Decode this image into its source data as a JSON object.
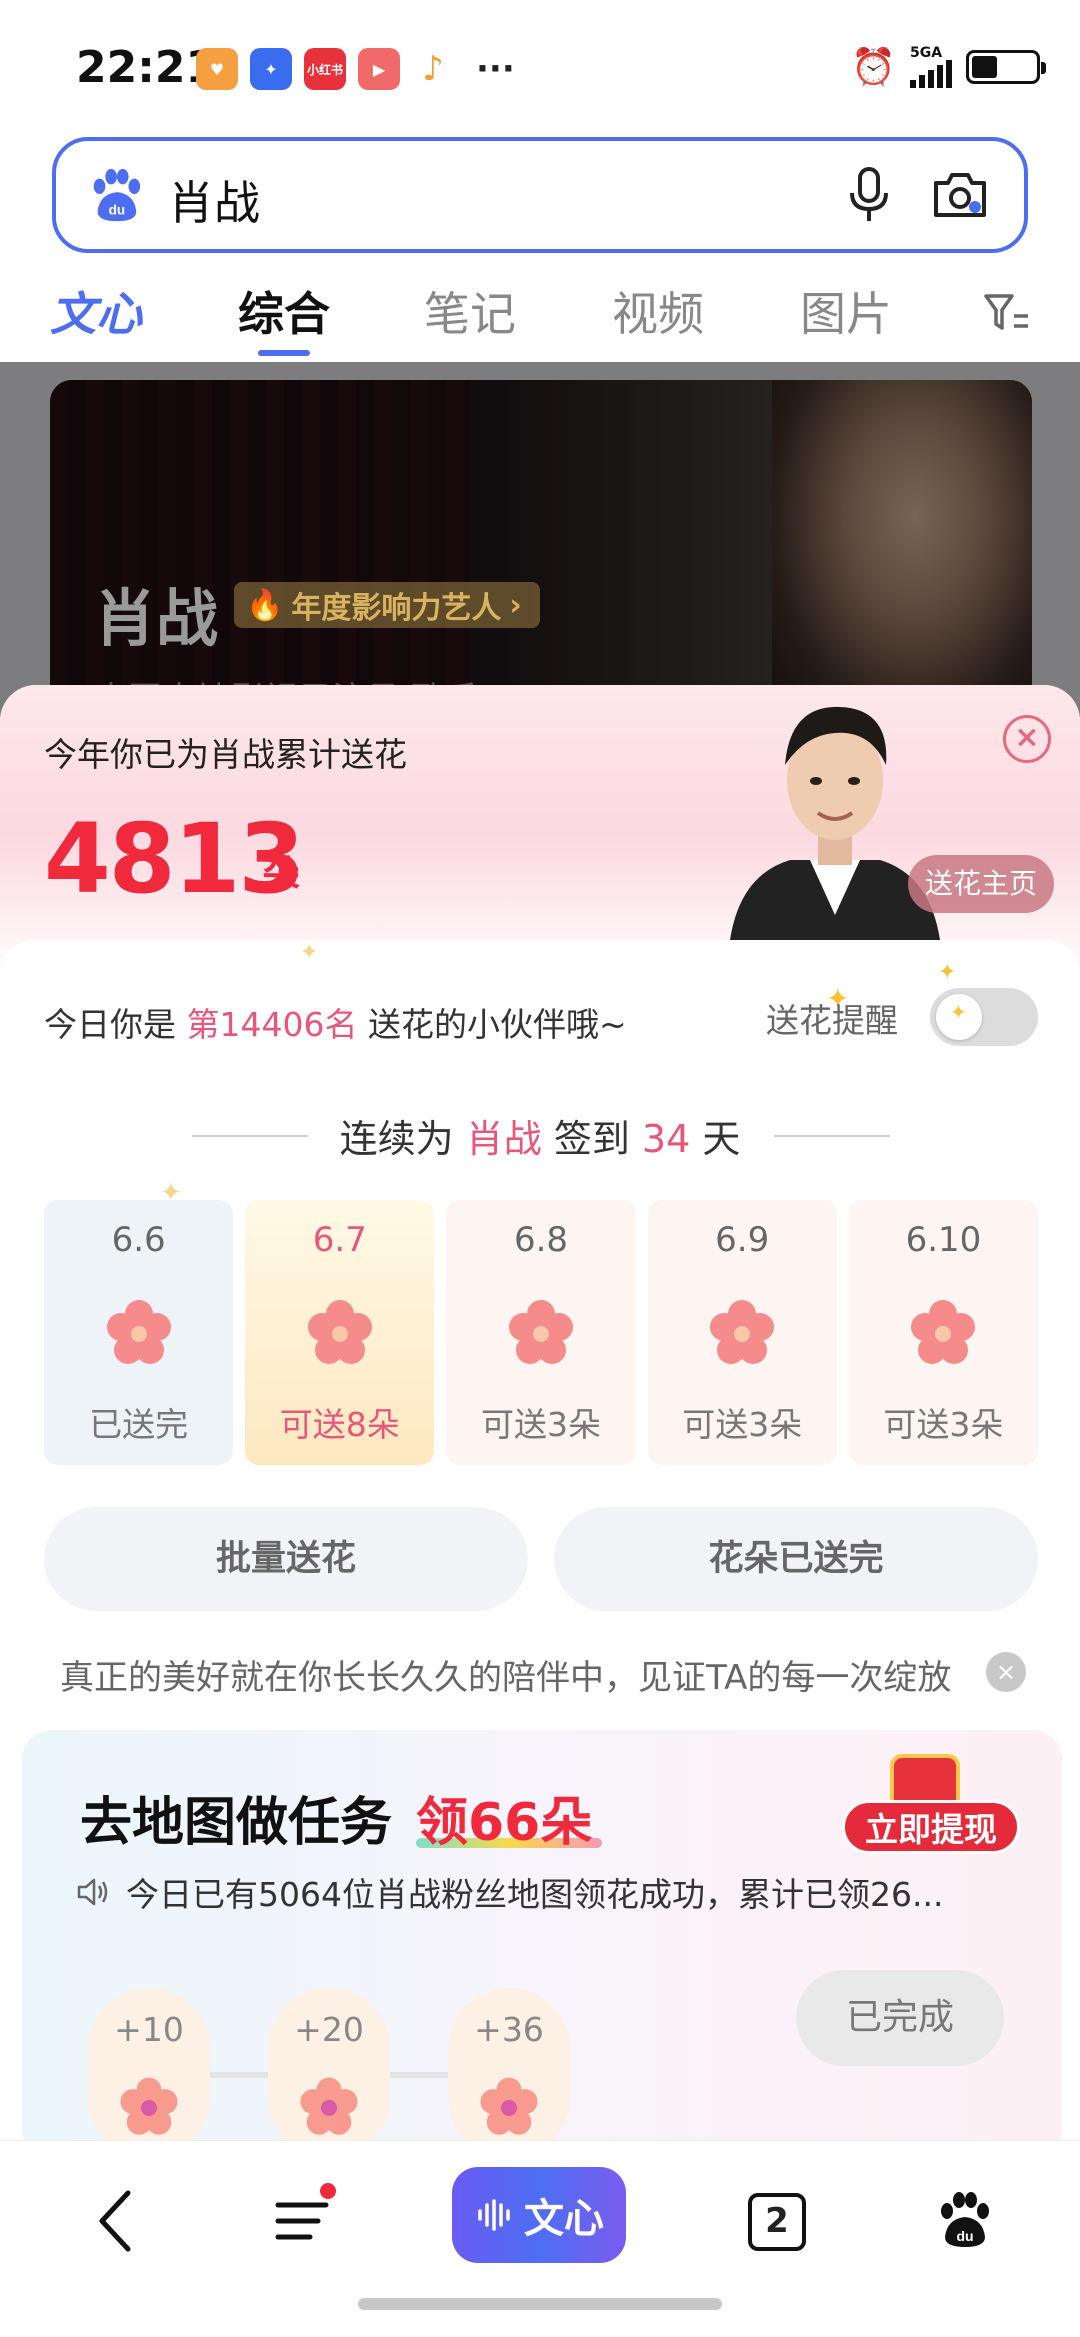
{
  "status_bar": {
    "time": "22:21",
    "network": "5GA",
    "apps": [
      {
        "name": "heart-app-icon",
        "color": "#f5a040",
        "label": ""
      },
      {
        "name": "star-app-icon",
        "color": "#3a6cf0",
        "label": ""
      },
      {
        "name": "xiaohongshu-icon",
        "color": "#e8323b",
        "label": "小红书"
      },
      {
        "name": "video-app-icon",
        "color": "#f06a6a",
        "label": ""
      }
    ]
  },
  "search": {
    "query": "肖战"
  },
  "tabs": [
    {
      "label": "文心"
    },
    {
      "label": "综合"
    },
    {
      "label": "笔记"
    },
    {
      "label": "视频"
    },
    {
      "label": "图片"
    }
  ],
  "hero": {
    "name": "肖战",
    "badge": "年度影响力艺人",
    "subtitle": "中国内地影视男演员,歌手"
  },
  "sheet": {
    "caption": "今年你已为肖战累计送花",
    "total": "4813",
    "unit": "朵",
    "home_button": "送花主页",
    "rank_prefix": "今日你是 ",
    "rank_value": "第14406名",
    "rank_suffix": " 送花的小伙伴哦~",
    "remind_label": "送花提醒",
    "remind_on": false,
    "streak_prefix": "连续为 ",
    "streak_name": "肖战",
    "streak_mid": " 签到 ",
    "streak_days": "34",
    "streak_suffix": " 天",
    "days": [
      {
        "date": "6.6",
        "status": "已送完"
      },
      {
        "date": "6.7",
        "status": "可送8朵"
      },
      {
        "date": "6.8",
        "status": "可送3朵"
      },
      {
        "date": "6.9",
        "status": "可送3朵"
      },
      {
        "date": "6.10",
        "status": "可送3朵"
      }
    ],
    "batch_button": "批量送花",
    "done_button": "花朵已送完",
    "quote": "真正的美好就在你长长久久的陪伴中，见证TA的每一次绽放"
  },
  "task": {
    "title": "去地图做任务",
    "reward": "领66朵",
    "notice": "今日已有5064位肖战粉丝地图领花成功，累计已领26...",
    "withdraw": "立即提现",
    "steps": [
      {
        "label": "+10"
      },
      {
        "label": "+20"
      },
      {
        "label": "+36"
      }
    ],
    "completed": "已完成"
  },
  "nav": {
    "wenxin": "文心",
    "tab_count": "2"
  },
  "colors": {
    "accent": "#4e6ef2",
    "highlight": "#f0293d",
    "pink": "#e8577b"
  }
}
